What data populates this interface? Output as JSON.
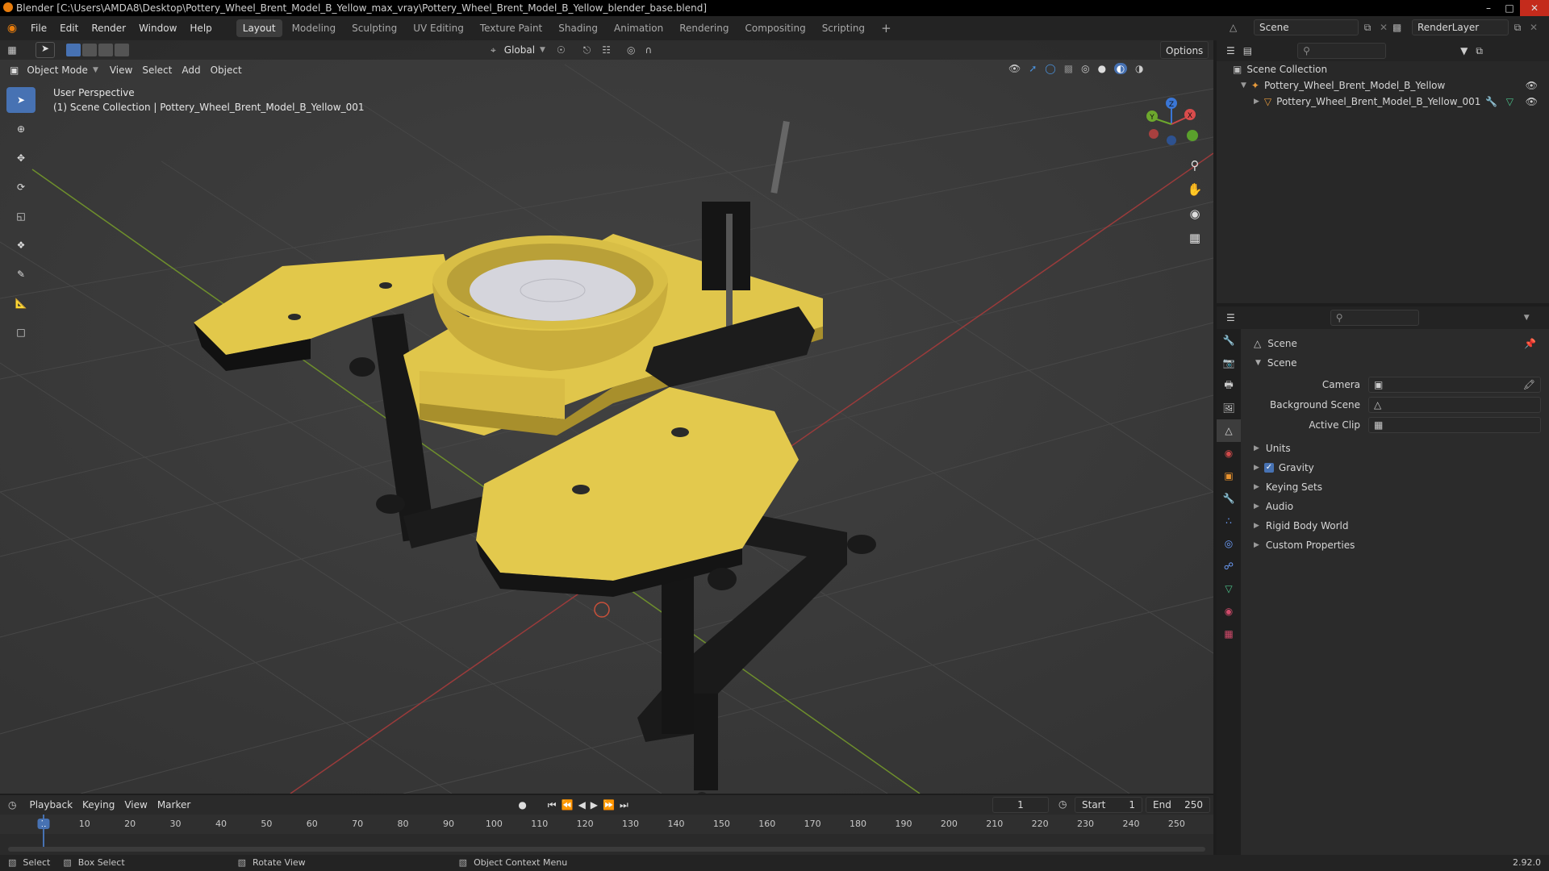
{
  "titlebar": {
    "title": "Blender [C:\\Users\\AMDA8\\Desktop\\Pottery_Wheel_Brent_Model_B_Yellow_max_vray\\Pottery_Wheel_Brent_Model_B_Yellow_blender_base.blend]"
  },
  "menus": [
    "File",
    "Edit",
    "Render",
    "Window",
    "Help"
  ],
  "workspaces": [
    "Layout",
    "Modeling",
    "Sculpting",
    "UV Editing",
    "Texture Paint",
    "Shading",
    "Animation",
    "Rendering",
    "Compositing",
    "Scripting"
  ],
  "scene_field": "Scene",
  "renderlayer_field": "RenderLayer",
  "tool_header": {
    "orientation": "Global",
    "options": "Options"
  },
  "viewport_header": {
    "mode": "Object Mode",
    "view": "View",
    "select": "Select",
    "add": "Add",
    "object": "Object"
  },
  "viewport": {
    "perspective": "User Perspective",
    "collection_info": "(1) Scene Collection | Pottery_Wheel_Brent_Model_B_Yellow_001",
    "gizmo": {
      "x": "X",
      "y": "Y",
      "z": "Z"
    }
  },
  "outliner": {
    "root": "Scene Collection",
    "items": [
      {
        "label": "Pottery_Wheel_Brent_Model_B_Yellow"
      },
      {
        "label": "Pottery_Wheel_Brent_Model_B_Yellow_001"
      }
    ]
  },
  "properties": {
    "header": "Scene",
    "section": "Scene",
    "fields": [
      {
        "label": "Camera"
      },
      {
        "label": "Background Scene"
      },
      {
        "label": "Active Clip"
      }
    ],
    "panels": [
      "Units",
      "Gravity",
      "Keying Sets",
      "Audio",
      "Rigid Body World",
      "Custom Properties"
    ]
  },
  "timeline": {
    "menus": [
      "Playback",
      "Keying",
      "View",
      "Marker"
    ],
    "current_frame": "1",
    "start_label": "Start",
    "start": "1",
    "end_label": "End",
    "end": "250",
    "ticks": [
      "1",
      "10",
      "20",
      "30",
      "40",
      "50",
      "60",
      "70",
      "80",
      "90",
      "100",
      "110",
      "120",
      "130",
      "140",
      "150",
      "160",
      "170",
      "180",
      "190",
      "200",
      "210",
      "220",
      "230",
      "240",
      "250"
    ]
  },
  "statusbar": {
    "select": "Select",
    "box_select": "Box Select",
    "rotate_view": "Rotate View",
    "context_menu": "Object Context Menu",
    "version": "2.92.0"
  },
  "colors": {
    "accent": "#4772b3",
    "yellow": "#e8cf4a",
    "viewport_bg": "#3d3d3d"
  }
}
